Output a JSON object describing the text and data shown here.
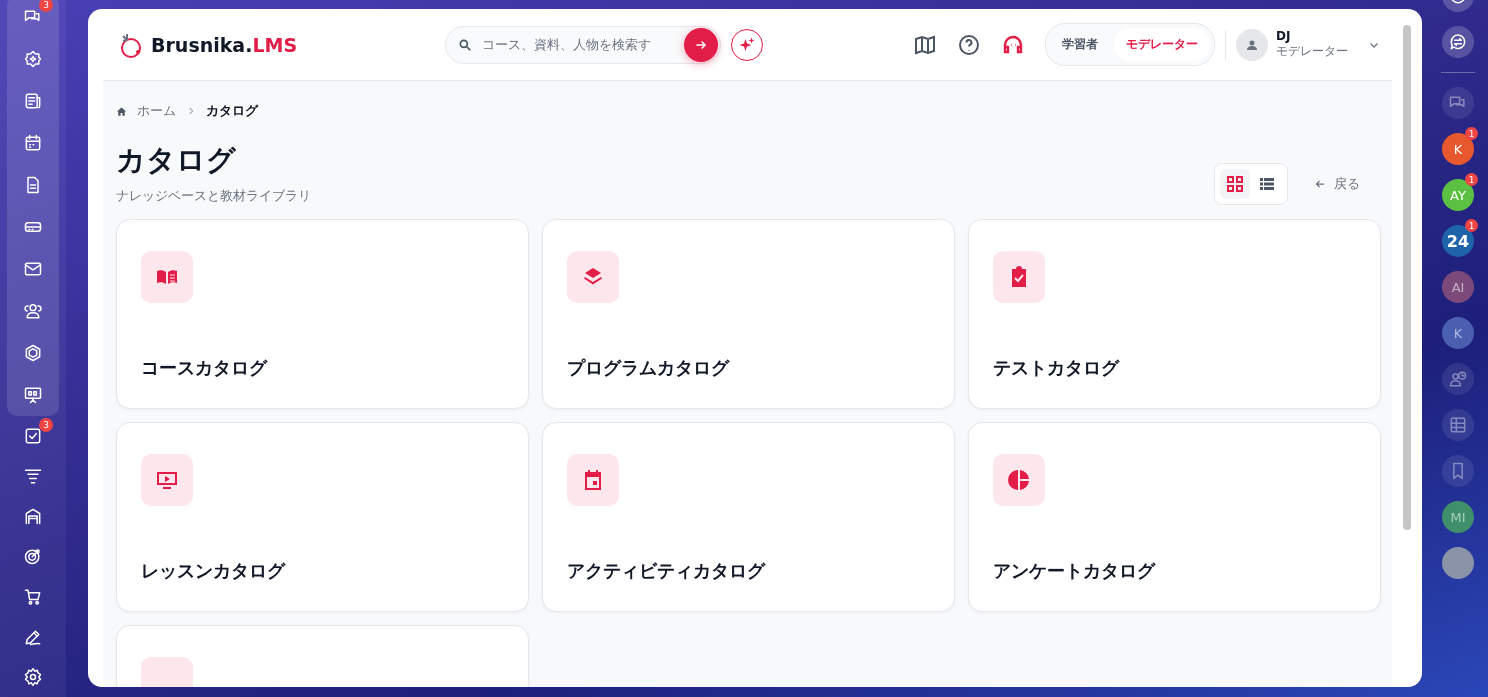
{
  "left_sidebar": {
    "items": [
      {
        "kind": "chat",
        "badge": "3",
        "grouped": true
      },
      {
        "kind": "sparkle",
        "grouped": true
      },
      {
        "kind": "news",
        "grouped": true
      },
      {
        "kind": "calendar",
        "grouped": true
      },
      {
        "kind": "document",
        "grouped": true
      },
      {
        "kind": "drive",
        "grouped": true
      },
      {
        "kind": "mail",
        "grouped": true
      },
      {
        "kind": "users",
        "grouped": true
      },
      {
        "kind": "hexagon",
        "grouped": true
      },
      {
        "kind": "board",
        "grouped": true
      },
      {
        "kind": "checkbox",
        "badge": "3",
        "grouped": false
      },
      {
        "kind": "filter",
        "grouped": false
      },
      {
        "kind": "garage",
        "grouped": false
      },
      {
        "kind": "target",
        "grouped": false
      },
      {
        "kind": "cart",
        "grouped": false
      },
      {
        "kind": "pen",
        "grouped": false
      },
      {
        "kind": "gear",
        "grouped": false
      }
    ]
  },
  "header": {
    "logo": {
      "name": "Brusnika.",
      "suffix": "LMS"
    },
    "search": {
      "placeholder": "コース、資料、人物を検索す"
    },
    "roles": [
      {
        "label": "学習者",
        "selected": false
      },
      {
        "label": "モデレーター",
        "selected": true
      }
    ],
    "user": {
      "name": "DJ",
      "role": "モデレーター"
    }
  },
  "breadcrumb": [
    {
      "label": "ホーム",
      "current": false
    },
    {
      "label": "カタログ",
      "current": true
    }
  ],
  "page": {
    "title": "カタログ",
    "subtitle": "ナレッジベースと教材ライブラリ",
    "back": "戻る"
  },
  "view_toggle": [
    {
      "kind": "grid",
      "selected": true
    },
    {
      "kind": "list",
      "selected": false
    }
  ],
  "cards": [
    {
      "kind": "book",
      "label": "コースカタログ"
    },
    {
      "kind": "layers",
      "label": "プログラムカタログ"
    },
    {
      "kind": "clipboard",
      "label": "テストカタログ"
    },
    {
      "kind": "video",
      "label": "レッスンカタログ"
    },
    {
      "kind": "event",
      "label": "アクティビティカタログ"
    },
    {
      "kind": "pie",
      "label": "アンケートカタログ"
    },
    {
      "kind": "unknown"
    }
  ],
  "right_dock": [
    {
      "kind": "smile",
      "dimmed": false
    },
    {
      "kind": "swap-chat",
      "dimmed": false
    },
    {
      "kind": "divider"
    },
    {
      "kind": "chat",
      "dimmed": true
    },
    {
      "kind": "initials",
      "text": "K",
      "color": "#e8582e",
      "badge": "1",
      "dimmed": false
    },
    {
      "kind": "initials",
      "text": "AY",
      "color": "#5cc043",
      "badge": "1",
      "dimmed": false
    },
    {
      "kind": "initials",
      "text": "24",
      "color": "#1f63a8",
      "badge": "1",
      "dimmed": false
    },
    {
      "kind": "initials",
      "text": "AI",
      "color": "#7b4a7a",
      "dimmed": true
    },
    {
      "kind": "initials",
      "text": "K",
      "color": "#4a5fb0",
      "dimmed": true
    },
    {
      "kind": "contact",
      "dimmed": true
    },
    {
      "kind": "table",
      "dimmed": true
    },
    {
      "kind": "bookmark",
      "dimmed": true
    },
    {
      "kind": "initials",
      "text": "MI",
      "color": "#3f8f6a",
      "dimmed": true
    },
    {
      "kind": "photo",
      "dimmed": false
    }
  ]
}
